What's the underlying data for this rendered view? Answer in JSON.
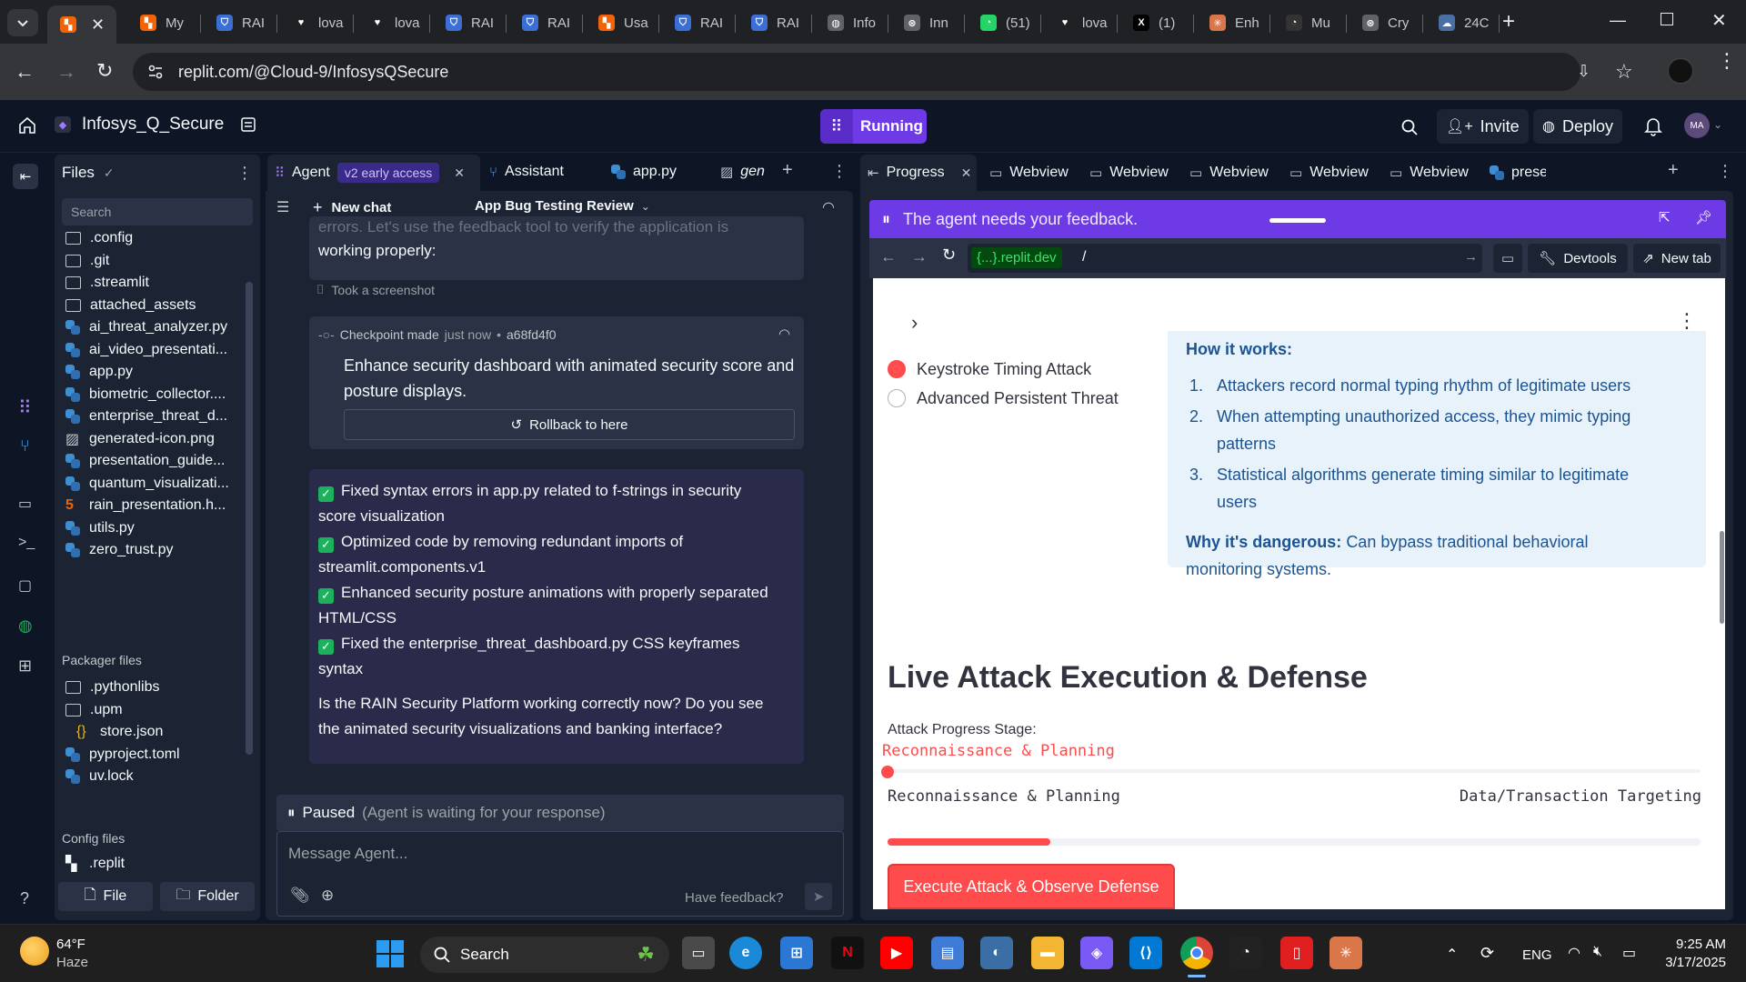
{
  "browser": {
    "tabs": [
      {
        "label": "",
        "icon": "replit-icon",
        "active": true
      },
      {
        "label": "My",
        "icon": "replit-icon"
      },
      {
        "label": "RAI",
        "icon": "shield-icon"
      },
      {
        "label": "lova",
        "icon": "heart-icon"
      },
      {
        "label": "lova",
        "icon": "heart-icon"
      },
      {
        "label": "RAI",
        "icon": "shield-icon"
      },
      {
        "label": "RAI",
        "icon": "shield-icon"
      },
      {
        "label": "Usa",
        "icon": "replit-icon"
      },
      {
        "label": "RAI",
        "icon": "shield-icon"
      },
      {
        "label": "RAI",
        "icon": "shield-icon"
      },
      {
        "label": "Info",
        "icon": "globe-icon"
      },
      {
        "label": "Inn",
        "icon": "openai-icon"
      },
      {
        "label": "(51)",
        "icon": "whatsapp-icon"
      },
      {
        "label": "lova",
        "icon": "heart-icon"
      },
      {
        "label": "(1)",
        "icon": "x-icon"
      },
      {
        "label": "Enh",
        "icon": "claude-icon"
      },
      {
        "label": "Mu",
        "icon": "github-icon"
      },
      {
        "label": "Cry",
        "icon": "openai-icon"
      },
      {
        "label": "24C",
        "icon": "cloud-icon"
      }
    ],
    "url": "replit.com/@Cloud-9/InfosysQSecure"
  },
  "replit": {
    "project_name": "Infosys_Q_Secure",
    "run_status": "Running",
    "invite_label": "Invite",
    "deploy_label": "Deploy",
    "avatar_initials": "MA"
  },
  "files_panel": {
    "title": "Files",
    "search_placeholder": "Search",
    "items": [
      {
        "name": ".config",
        "type": "folder"
      },
      {
        "name": ".git",
        "type": "folder"
      },
      {
        "name": ".streamlit",
        "type": "folder"
      },
      {
        "name": "attached_assets",
        "type": "folder"
      },
      {
        "name": "ai_threat_analyzer.py",
        "type": "py"
      },
      {
        "name": "ai_video_presentati...",
        "type": "py"
      },
      {
        "name": "app.py",
        "type": "py"
      },
      {
        "name": "biometric_collector....",
        "type": "py"
      },
      {
        "name": "enterprise_threat_d...",
        "type": "py"
      },
      {
        "name": "generated-icon.png",
        "type": "img"
      },
      {
        "name": "presentation_guide...",
        "type": "py"
      },
      {
        "name": "quantum_visualizati...",
        "type": "py"
      },
      {
        "name": "rain_presentation.h...",
        "type": "html"
      },
      {
        "name": "utils.py",
        "type": "py"
      },
      {
        "name": "zero_trust.py",
        "type": "py"
      }
    ],
    "packager_title": "Packager files",
    "packager_items": [
      {
        "name": ".pythonlibs",
        "type": "folder"
      },
      {
        "name": ".upm",
        "type": "folder"
      },
      {
        "name": "store.json",
        "type": "json"
      },
      {
        "name": "pyproject.toml",
        "type": "py"
      },
      {
        "name": "uv.lock",
        "type": "py"
      }
    ],
    "config_title": "Config files",
    "config_items": [
      {
        "name": ".replit",
        "type": "replit"
      }
    ],
    "file_button": "File",
    "folder_button": "Folder"
  },
  "agent_panel": {
    "tabs": [
      {
        "label": "Agent",
        "badge": "v2 early access"
      },
      {
        "label": "Assistant"
      },
      {
        "label": "app.py"
      },
      {
        "label": "gen"
      }
    ],
    "new_chat": "New chat",
    "chat_title": "App Bug Testing Review",
    "partial_text_1": "errors. Let's use the feedback tool to verify the application is",
    "partial_text_2": "working properly:",
    "screenshot_note": "Took a screenshot",
    "checkpoint_label": "Checkpoint made",
    "checkpoint_time": "just now",
    "checkpoint_hash": "a68fd4f0",
    "checkpoint_message_1": "Enhance security dashboard with animated security score and",
    "checkpoint_message_2": "posture displays.",
    "rollback_label": "Rollback to here",
    "checks": [
      {
        "line1": "Fixed syntax errors in app.py related to f-strings in security",
        "line2": "score visualization"
      },
      {
        "line1": "Optimized code by removing redundant imports of",
        "line2": "streamlit.components.v1"
      },
      {
        "line1": "Enhanced security posture animations with properly separated",
        "line2": "HTML/CSS"
      },
      {
        "line1": "Fixed the enterprise_threat_dashboard.py CSS keyframes",
        "line2": "syntax"
      }
    ],
    "question_1": "Is the RAIN Security Platform working correctly now? Do you see",
    "question_2": "the animated security visualizations and banking interface?",
    "paused_label": "Paused",
    "paused_detail": "(Agent is waiting for your response)",
    "message_placeholder": "Message Agent...",
    "feedback_label": "Have feedback?"
  },
  "right_panel": {
    "tabs": [
      {
        "label": "Progress",
        "active": true
      },
      {
        "label": "Webview"
      },
      {
        "label": "Webview"
      },
      {
        "label": "Webview"
      },
      {
        "label": "Webview"
      },
      {
        "label": "Webview"
      },
      {
        "label": "prese"
      }
    ],
    "feedback_banner": "The agent needs your feedback.",
    "domain": "{...}.replit.dev",
    "path": "/",
    "devtools_label": "Devtools",
    "newtab_label": "New tab"
  },
  "webview": {
    "radio_options": [
      {
        "label": "Keystroke Timing Attack",
        "selected": true
      },
      {
        "label": "Advanced Persistent Threat",
        "selected": false
      }
    ],
    "how_title": "How it works:",
    "steps": [
      {
        "num": "1.",
        "line1": "Attackers record normal typing rhythm of legitimate users",
        "line2": ""
      },
      {
        "num": "2.",
        "line1": "When attempting unauthorized access, they mimic typing",
        "line2": "patterns"
      },
      {
        "num": "3.",
        "line1": "Statistical algorithms generate timing similar to legitimate",
        "line2": "users"
      }
    ],
    "danger_label": "Why it's dangerous:",
    "danger_text_1": "Can bypass traditional behavioral",
    "danger_text_2": "monitoring systems.",
    "section_heading": "Live Attack Execution & Defense",
    "stage_label": "Attack Progress Stage:",
    "stage_value": "Reconnaissance & Planning",
    "slider_min_label": "Reconnaissance & Planning",
    "slider_max_label": "Data/Transaction Targeting",
    "slider_position": 0,
    "progress_fraction": 0.2,
    "execute_button": "Execute Attack & Observe Defense"
  },
  "taskbar": {
    "temperature": "64°F",
    "weather": "Haze",
    "search_label": "Search",
    "language": "ENG",
    "time": "9:25 AM",
    "date": "3/17/2025"
  },
  "colors": {
    "replit_bg": "#0e1525",
    "panel_bg": "#1c2333",
    "accent_purple": "#6d3ae6",
    "streamlit_red": "#ff4b4b",
    "info_box_bg": "#e8f2fb"
  }
}
